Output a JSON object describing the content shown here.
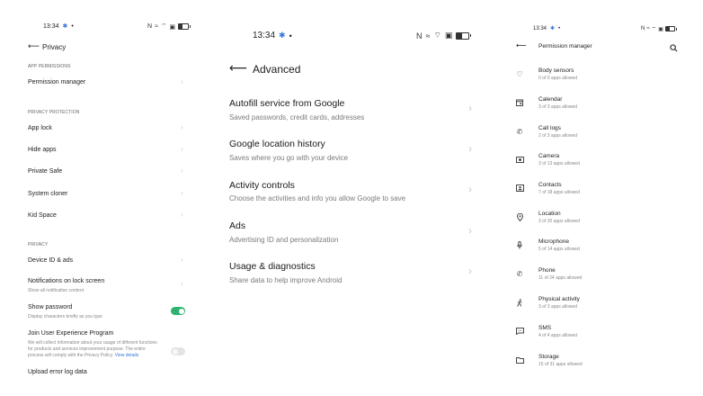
{
  "panel1": {
    "status": {
      "time": "13:34"
    },
    "title": "Privacy",
    "sections": [
      {
        "header": "APP PERMISSIONS",
        "items": [
          "Permission manager"
        ]
      },
      {
        "header": "PRIVACY PROTECTION",
        "items": [
          "App lock",
          "Hide apps",
          "Private Safe",
          "System cloner",
          "Kid Space"
        ]
      },
      {
        "header": "PRIVACY",
        "items": [
          "Device ID & ads"
        ]
      }
    ],
    "notifications": {
      "title": "Notifications on lock screen",
      "subtitle": "Show all notification content"
    },
    "show_password": {
      "title": "Show password",
      "subtitle": "Display characters briefly as you type",
      "enabled": true
    },
    "join_program": {
      "title": "Join User Experience Program",
      "subtitle_lines": [
        "We will collect information about your usage of different functions",
        "for products and services improvement purpose. The entire",
        "process will comply with the Privacy Policy."
      ],
      "link": "View details",
      "enabled": false
    },
    "upload": "Upload error log data"
  },
  "panel2": {
    "status": {
      "time": "13:34"
    },
    "title": "Advanced",
    "items": [
      {
        "title": "Autofill service from Google",
        "subtitle": "Saved passwords, credit cards, addresses"
      },
      {
        "title": "Google location history",
        "subtitle": "Saves where you go with your device"
      },
      {
        "title": "Activity controls",
        "subtitle": "Choose the activities and info you allow Google to save"
      },
      {
        "title": "Ads",
        "subtitle": "Advertising ID and personalization"
      },
      {
        "title": "Usage & diagnostics",
        "subtitle": "Share data to help improve Android"
      }
    ]
  },
  "panel3": {
    "status": {
      "time": "13:34"
    },
    "title": "Permission manager",
    "items": [
      {
        "title": "Body sensors",
        "subtitle": "0 of 0 apps allowed",
        "icon": "heart-icon"
      },
      {
        "title": "Calendar",
        "subtitle": "3 of 3 apps allowed",
        "icon": "calendar-icon"
      },
      {
        "title": "Call logs",
        "subtitle": "2 of 3 apps allowed",
        "icon": "call-log-icon"
      },
      {
        "title": "Camera",
        "subtitle": "3 of 13 apps allowed",
        "icon": "camera-icon"
      },
      {
        "title": "Contacts",
        "subtitle": "7 of 18 apps allowed",
        "icon": "contacts-icon"
      },
      {
        "title": "Location",
        "subtitle": "3 of 20 apps allowed",
        "icon": "location-icon"
      },
      {
        "title": "Microphone",
        "subtitle": "5 of 14 apps allowed",
        "icon": "microphone-icon"
      },
      {
        "title": "Phone",
        "subtitle": "11 of 24 apps allowed",
        "icon": "phone-icon"
      },
      {
        "title": "Physical activity",
        "subtitle": "3 of 3 apps allowed",
        "icon": "walking-icon"
      },
      {
        "title": "SMS",
        "subtitle": "4 of 4 apps allowed",
        "icon": "sms-icon"
      },
      {
        "title": "Storage",
        "subtitle": "15 of 31 apps allowed",
        "icon": "folder-icon"
      }
    ]
  },
  "colors": {
    "toggle_on": "#2db36e",
    "toggle_off": "#e4e4e4",
    "link": "#3a78d8",
    "chevron": "#c9c9c9"
  }
}
